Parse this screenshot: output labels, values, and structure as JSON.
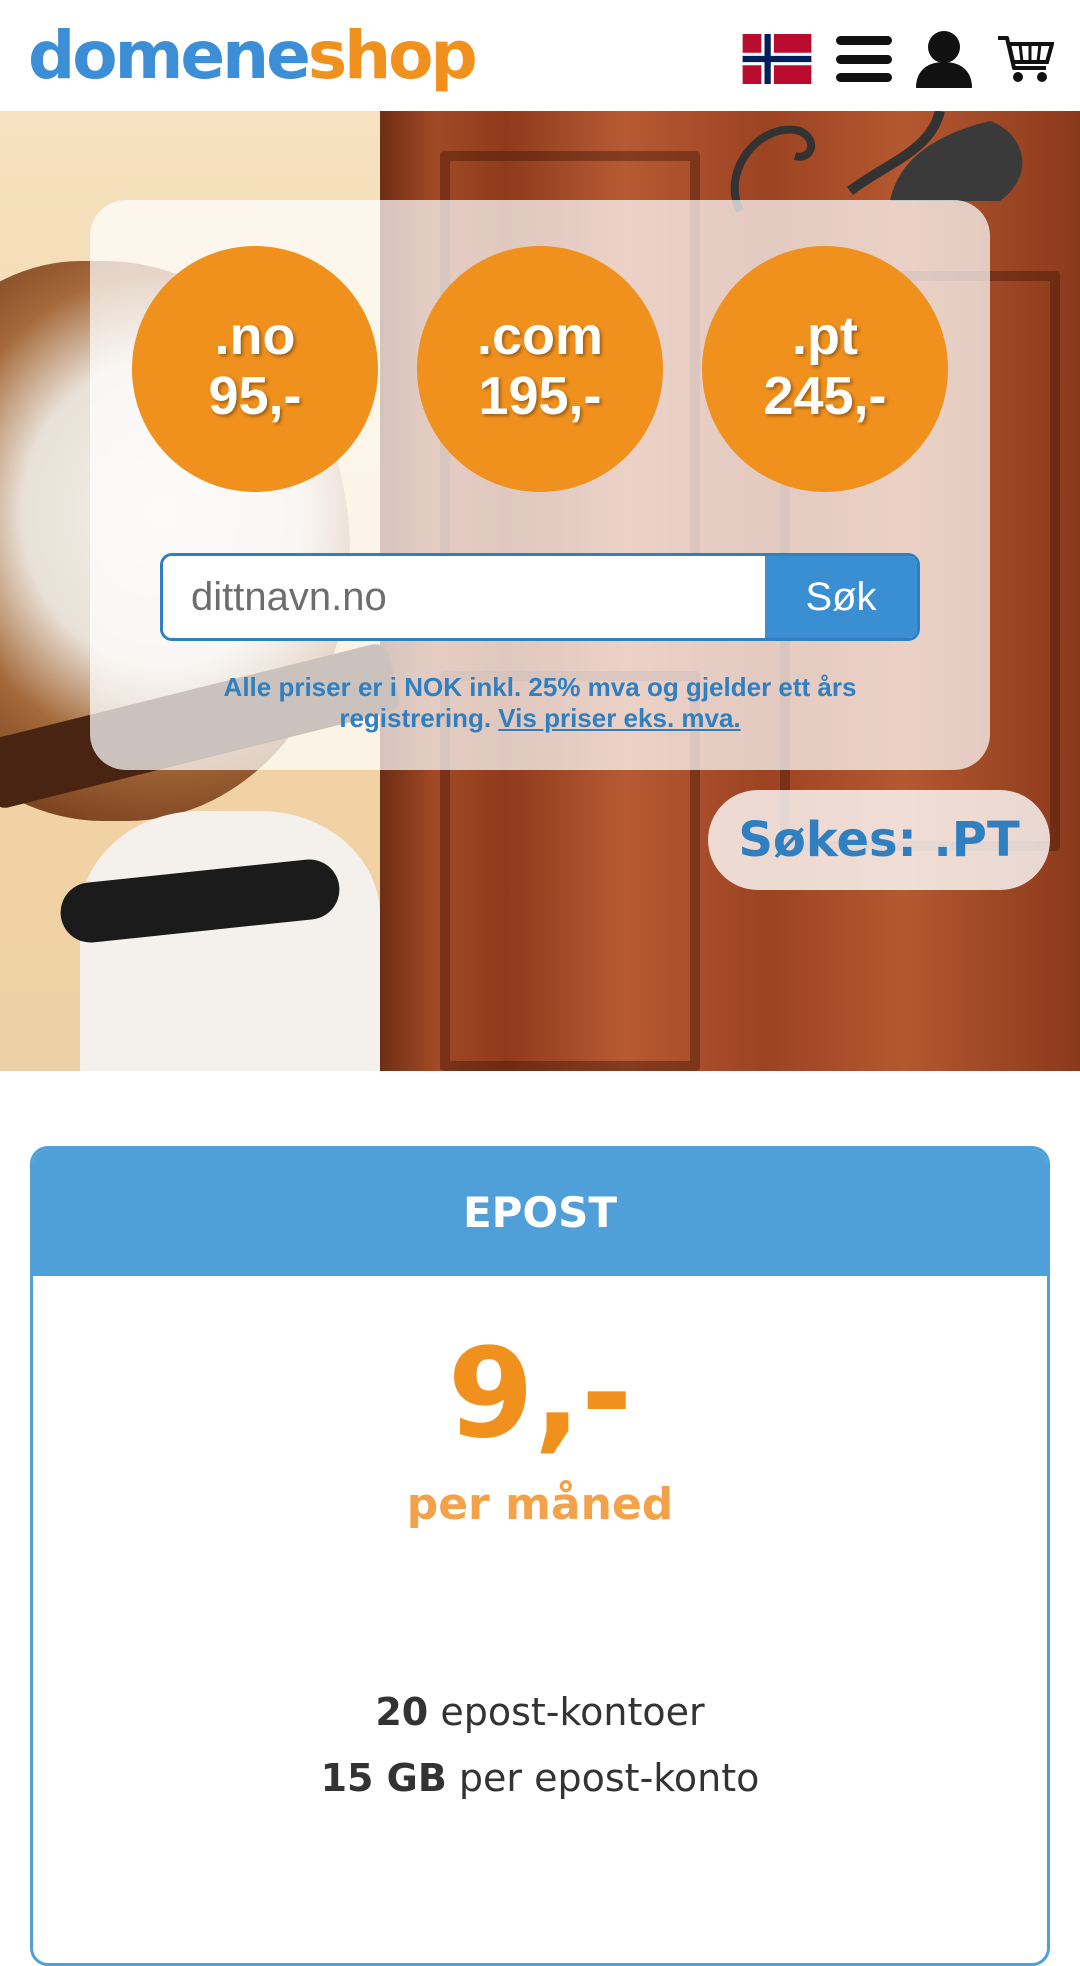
{
  "header": {
    "logo_part_1": "domene",
    "logo_part_2": "shop",
    "icons": [
      "norway-flag-icon",
      "menu-icon",
      "user-icon",
      "cart-icon"
    ]
  },
  "hero": {
    "tlds": [
      {
        "tld": ".no",
        "price": "95,-"
      },
      {
        "tld": ".com",
        "price": "195,-"
      },
      {
        "tld": ".pt",
        "price": "245,-"
      }
    ],
    "search": {
      "placeholder": "dittnavn.no",
      "button_label": "Søk"
    },
    "price_note": "Alle priser er i NOK inkl. 25% mva og gjelder ett års registrering.",
    "price_note_link": "Vis priser eks. mva.",
    "soekes_label": "Søkes: .PT"
  },
  "epost_card": {
    "title": "EPOST",
    "price": "9,-",
    "period": "per måned",
    "features": [
      {
        "value": "20",
        "text": "epost-kontoer"
      },
      {
        "value": "15 GB",
        "text": "per epost-konto"
      }
    ]
  },
  "colors": {
    "brand_blue": "#3c8fd6",
    "brand_orange": "#f0901d",
    "card_blue": "#4f9fd8"
  }
}
